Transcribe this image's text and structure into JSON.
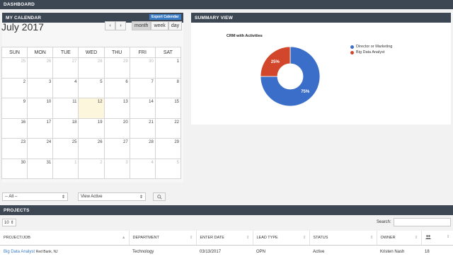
{
  "topbar": {
    "title": "DASHBOARD"
  },
  "calendar": {
    "header": "MY CALENDAR",
    "month_title": "July 2017",
    "export_label": "Export Calendar",
    "prev_label": "‹",
    "next_label": "›",
    "views": [
      "month",
      "week",
      "day"
    ],
    "active_view": "month",
    "weekdays": [
      "SUN",
      "MON",
      "TUE",
      "WED",
      "THU",
      "FRI",
      "SAT"
    ],
    "weeks": [
      [
        {
          "d": "25",
          "o": true
        },
        {
          "d": "26",
          "o": true
        },
        {
          "d": "27",
          "o": true
        },
        {
          "d": "28",
          "o": true
        },
        {
          "d": "29",
          "o": true
        },
        {
          "d": "30",
          "o": true
        },
        {
          "d": "1",
          "o": false
        }
      ],
      [
        {
          "d": "2",
          "o": false
        },
        {
          "d": "3",
          "o": false
        },
        {
          "d": "4",
          "o": false
        },
        {
          "d": "5",
          "o": false
        },
        {
          "d": "6",
          "o": false
        },
        {
          "d": "7",
          "o": false
        },
        {
          "d": "8",
          "o": false
        }
      ],
      [
        {
          "d": "9",
          "o": false
        },
        {
          "d": "10",
          "o": false
        },
        {
          "d": "11",
          "o": false
        },
        {
          "d": "12",
          "o": false,
          "today": true
        },
        {
          "d": "13",
          "o": false
        },
        {
          "d": "14",
          "o": false
        },
        {
          "d": "15",
          "o": false
        }
      ],
      [
        {
          "d": "16",
          "o": false
        },
        {
          "d": "17",
          "o": false
        },
        {
          "d": "18",
          "o": false
        },
        {
          "d": "19",
          "o": false
        },
        {
          "d": "20",
          "o": false
        },
        {
          "d": "21",
          "o": false
        },
        {
          "d": "22",
          "o": false
        }
      ],
      [
        {
          "d": "23",
          "o": false
        },
        {
          "d": "24",
          "o": false
        },
        {
          "d": "25",
          "o": false
        },
        {
          "d": "26",
          "o": false
        },
        {
          "d": "27",
          "o": false
        },
        {
          "d": "28",
          "o": false
        },
        {
          "d": "29",
          "o": false
        }
      ],
      [
        {
          "d": "30",
          "o": false
        },
        {
          "d": "31",
          "o": false
        },
        {
          "d": "1",
          "o": true
        },
        {
          "d": "2",
          "o": true
        },
        {
          "d": "3",
          "o": true
        },
        {
          "d": "4",
          "o": true
        },
        {
          "d": "5",
          "o": true
        }
      ]
    ]
  },
  "summary": {
    "header": "SUMMARY VIEW",
    "chart_title": "CRM with Activities"
  },
  "chart_data": {
    "type": "pie",
    "title": "CRM with Activities",
    "categories": [
      "Director or Marketing",
      "Big Data Analyst"
    ],
    "values": [
      75,
      25
    ],
    "labels": [
      "75%",
      "25%"
    ],
    "colors": [
      "#3a6ec9",
      "#d2472b"
    ],
    "legend_position": "right"
  },
  "filters": {
    "all_label": "-- All --",
    "status_label": "View Active"
  },
  "projects": {
    "header": "PROJECTS",
    "page_length": "10",
    "search_label": "Search:",
    "columns": [
      "PROJECT/JOB",
      "DEPARTMENT",
      "ENTER DATE",
      "LEAD TYPE",
      "STATUS",
      "OWNER"
    ],
    "rows": [
      {
        "project": "Big Data Analyst",
        "location": "Red Bank, NJ",
        "department": "Technology",
        "enter_date": "03/13/2017",
        "lead_type": "OPN",
        "status": "Active",
        "owner": "Kristen Nash",
        "count": "18"
      }
    ]
  }
}
